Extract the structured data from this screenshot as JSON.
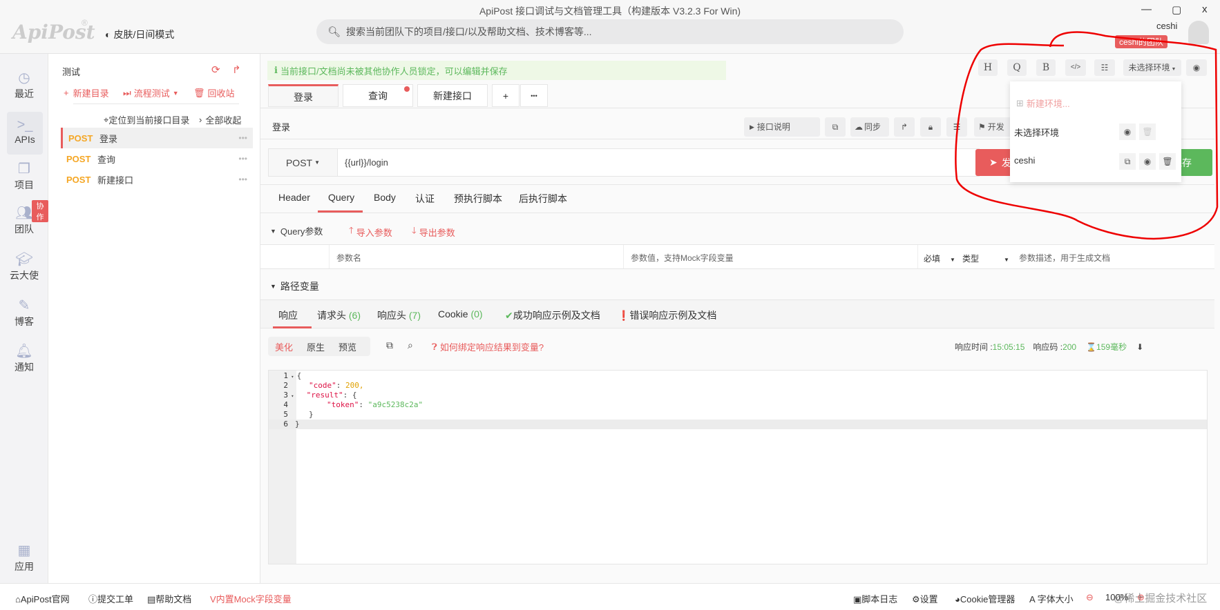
{
  "window": {
    "title": "ApiPost 接口调试与文档管理工具（构建版本 V3.2.3 For Win)",
    "minimize": "—",
    "maximize": "▢",
    "close": "x"
  },
  "header": {
    "logo": "ApiPost",
    "logo_mark": "®",
    "skin_toggle": "皮肤/日间模式",
    "search_placeholder": "搜索当前团队下的项目/接口/以及帮助文档、技术博客等...",
    "user": "ceshi",
    "team_badge": "ceshi的团队"
  },
  "rail": [
    {
      "label": "最近",
      "icon": "clock-icon"
    },
    {
      "label": "APIs",
      "icon": "terminal-icon"
    },
    {
      "label": "项目",
      "icon": "projects-icon"
    },
    {
      "label": "团队",
      "icon": "team-icon",
      "badge": "协作"
    },
    {
      "label": "云大使",
      "icon": "graduation-cap-icon"
    },
    {
      "label": "博客",
      "icon": "edit-icon"
    },
    {
      "label": "通知",
      "icon": "bell-icon"
    },
    {
      "label": "应用",
      "icon": "apps-icon"
    }
  ],
  "tree": {
    "project": "测试",
    "new_folder": "新建目录",
    "flow_test": "流程测试",
    "recycle": "回收站",
    "locate": "定位到当前接口目录",
    "collapse_all": "全部收起",
    "items": [
      {
        "method": "POST",
        "name": "登录"
      },
      {
        "method": "POST",
        "name": "查询"
      },
      {
        "method": "POST",
        "name": "新建接口"
      }
    ]
  },
  "notice": "当前接口/文档尚未被其他协作人员锁定，可以编辑并保存",
  "tabs": [
    {
      "label": "登录"
    },
    {
      "label": "查询"
    },
    {
      "label": "新建接口"
    }
  ],
  "tab_add": "+",
  "tab_more": "•••",
  "toolbar": {
    "h": "H",
    "q": "Q",
    "b": "B",
    "code": "</>",
    "env_select": "未选择环境"
  },
  "env_dropdown": {
    "new_env": "新建环境...",
    "items": [
      "未选择环境",
      "ceshi"
    ]
  },
  "api": {
    "name": "登录",
    "doc_btn": "接口说明",
    "sync": "同步",
    "dev": "开发",
    "method": "POST",
    "url": "{{url}}/login",
    "send": "发送",
    "save": "保存"
  },
  "req_tabs": [
    "Header",
    "Query",
    "Body",
    "认证",
    "预执行脚本",
    "后执行脚本"
  ],
  "query": {
    "title": "Query参数",
    "import": "导入参数",
    "export": "导出参数",
    "col_name": "参数名",
    "col_value": "参数值，支持Mock字段变量",
    "col_required": "必填",
    "col_type": "类型",
    "col_desc": "参数描述，用于生成文档",
    "path_vars": "路径变量"
  },
  "resp_tabs": [
    {
      "label": "响应"
    },
    {
      "label": "请求头",
      "count": "(6)"
    },
    {
      "label": "响应头",
      "count": "(7)"
    },
    {
      "label": "Cookie",
      "count": "(0)"
    },
    {
      "label": "成功响应示例及文档"
    },
    {
      "label": "错误响应示例及文档"
    }
  ],
  "resp_toolbar": {
    "pretty": "美化",
    "raw": "原生",
    "preview": "预览",
    "help": "如何绑定响应结果到变量?",
    "time_label": "响应时间 : ",
    "time": "15:05:15",
    "code_label": "响应码 : ",
    "code": "200",
    "duration": "159毫秒"
  },
  "code_lines": [
    {
      "n": "1",
      "t": "{"
    },
    {
      "n": "2",
      "k": "\"code\"",
      "v": "200,"
    },
    {
      "n": "3",
      "k": "\"result\"",
      "t2": ": {"
    },
    {
      "n": "4",
      "k": "\"token\"",
      "s": "\"a9c5238c2a\""
    },
    {
      "n": "5",
      "t": "}"
    },
    {
      "n": "6",
      "t": "}"
    }
  ],
  "status": {
    "site": "ApiPost官网",
    "ticket": "提交工单",
    "help": "帮助文档",
    "mock": "内置Mock字段变量",
    "log": "脚本日志",
    "settings": "设置",
    "cookie": "Cookie管理器",
    "font": "字体大小",
    "zoom": "100%",
    "watermark": "@稀土掘金技术社区"
  },
  "colors": {
    "accent": "#e85c5c",
    "success": "#5cb85c",
    "post": "#f5a623"
  }
}
